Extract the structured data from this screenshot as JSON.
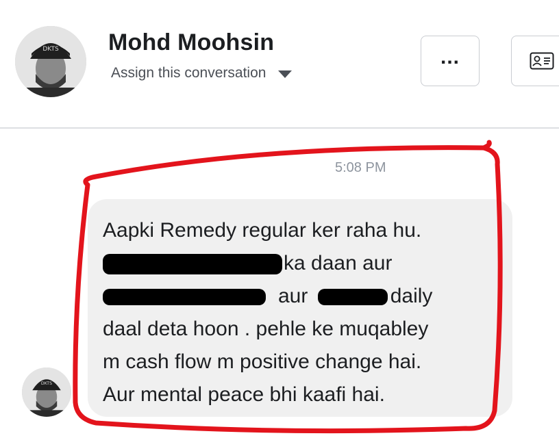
{
  "header": {
    "contact_name": "Mohd Moohsin",
    "assign_label": "Assign this conversation",
    "more_button_label": "...",
    "contact_card_icon": "contact-card-icon",
    "dropdown_icon": "caret-down-icon"
  },
  "conversation": {
    "timestamp": "5:08 PM",
    "message_lines": [
      "Aapki Remedy regular ker raha hu.",
      "ka daan aur",
      "aur",
      "daily",
      "daal deta hoon  . pehle ke muqabley",
      "m cash flow m positive change hai.",
      "Aur mental peace bhi kaafi hai."
    ]
  },
  "colors": {
    "bubble_bg": "#f0f0f0",
    "annotation_red": "#e3141c",
    "timestamp": "#8d949e",
    "divider": "#dddfe2"
  }
}
